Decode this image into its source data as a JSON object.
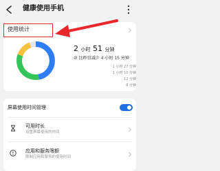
{
  "header": {
    "title": "健康使用手机",
    "back_icon": "back-arrow-icon",
    "more_icon": "more-vertical-icon"
  },
  "usage": {
    "section_title": "使用统计",
    "total_hours": "2",
    "hour_unit": "小时",
    "total_minutes": "51",
    "minute_unit": "分钟",
    "compare_text": "比昨日减少 4 小时 15 分钟",
    "axis_labels": [
      "1 小时 27 分钟",
      "1 小时 10 分钟",
      "12 分钟",
      "8 分钟"
    ]
  },
  "screen_time": {
    "title": "屏幕使用时间管理",
    "toggle_on": true,
    "items": [
      {
        "title": "可用时长",
        "subtitle": "设置屏幕使用的时间",
        "icon": "hourglass-icon"
      },
      {
        "title": "应用和服务限额",
        "subtitle": "限制应用和服务的使用时间",
        "icon": "info-circle-icon"
      }
    ]
  },
  "colors": {
    "accent": "#1f6de0",
    "highlight": "#e8282d",
    "ring_blue": "#2f7df6",
    "ring_green": "#33c45a",
    "ring_yellow": "#f5c33b",
    "ring_track": "#e6e6e6"
  }
}
